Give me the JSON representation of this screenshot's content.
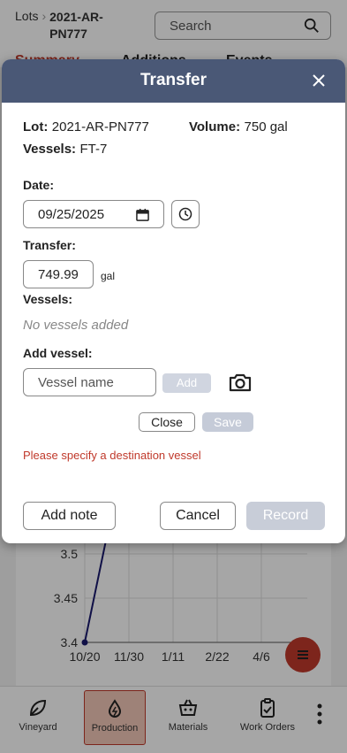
{
  "header": {
    "breadcrumb_root": "Lots",
    "breadcrumb_lot": "2021-AR-PN777",
    "search_placeholder": "Search"
  },
  "tabs": [
    {
      "label": "Summary"
    },
    {
      "label": "Additions"
    },
    {
      "label": "Events"
    }
  ],
  "chart_data": {
    "type": "line",
    "x_tick_labels": [
      "10/20",
      "11/30",
      "1/11",
      "2/22",
      "4/6"
    ],
    "y_tick_labels": [
      "3.4",
      "3.45",
      "3.5"
    ],
    "series": [
      {
        "x": [
          "10/20",
          "11/30"
        ],
        "y": [
          3.4,
          3.55
        ]
      }
    ]
  },
  "modal": {
    "title": "Transfer",
    "lot_label": "Lot:",
    "lot_value": "2021-AR-PN777",
    "volume_label": "Volume:",
    "volume_value": "750 gal",
    "vessels_label": "Vessels:",
    "vessels_value": "FT-7",
    "date_label": "Date:",
    "date_value": "09/25/2025",
    "transfer_label": "Transfer:",
    "transfer_value": "749.99",
    "transfer_unit": "gal",
    "vessels_list_label": "Vessels:",
    "vessels_empty": "No vessels added",
    "add_vessel_label": "Add vessel:",
    "vessel_placeholder": "Vessel name",
    "add_button": "Add",
    "close_button": "Close",
    "save_button": "Save",
    "error": "Please specify a destination vessel",
    "add_note_button": "Add note",
    "cancel_button": "Cancel",
    "record_button": "Record"
  },
  "nav": [
    {
      "label": "Vineyard",
      "icon": "leaf-icon"
    },
    {
      "label": "Production",
      "icon": "flask-icon"
    },
    {
      "label": "Materials",
      "icon": "basket-icon"
    },
    {
      "label": "Work Orders",
      "icon": "clipboard-check-icon"
    }
  ],
  "colors": {
    "accent": "#c0392b",
    "modal_header": "#4a5876"
  }
}
